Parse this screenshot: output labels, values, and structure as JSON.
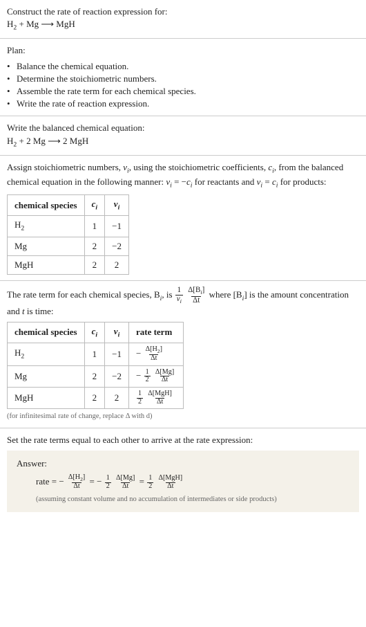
{
  "header": {
    "title": "Construct the rate of reaction expression for:",
    "equation_lhs1": "H",
    "equation_lhs1_sub": "2",
    "equation_plus": " + Mg ⟶ MgH"
  },
  "plan": {
    "title": "Plan:",
    "items": [
      "Balance the chemical equation.",
      "Determine the stoichiometric numbers.",
      "Assemble the rate term for each chemical species.",
      "Write the rate of reaction expression."
    ]
  },
  "balanced": {
    "heading": "Write the balanced chemical equation:",
    "eq_h": "H",
    "eq_h_sub": "2",
    "eq_rest": " + 2 Mg ⟶ 2 MgH"
  },
  "assign": {
    "text_a": "Assign stoichiometric numbers, ",
    "nu_i": "ν",
    "i_sub": "i",
    "text_b": ", using the stoichiometric coefficients, ",
    "c_i": "c",
    "text_c": ", from the balanced chemical equation in the following manner: ",
    "eq1_lhs": "ν",
    "eq1_eq": " = −",
    "eq1_rhs": "c",
    "text_d": " for reactants and ",
    "eq2_lhs": "ν",
    "eq2_eq": " = ",
    "eq2_rhs": "c",
    "text_e": " for products:"
  },
  "table1": {
    "h1": "chemical species",
    "h2": "c",
    "h2_sub": "i",
    "h3": "ν",
    "h3_sub": "i",
    "rows": [
      {
        "sp_h": "H",
        "sp_sub": "2",
        "c": "1",
        "nu": "−1"
      },
      {
        "sp": "Mg",
        "c": "2",
        "nu": "−2"
      },
      {
        "sp": "MgH",
        "c": "2",
        "nu": "2"
      }
    ]
  },
  "rate_intro": {
    "a": "The rate term for each chemical species, B",
    "i_sub": "i",
    "b": ", is ",
    "frac1_num": "1",
    "frac1_den_nu": "ν",
    "frac1_den_sub": "i",
    "frac2_num_d": "Δ[B",
    "frac2_num_close": "]",
    "frac2_den": "Δt",
    "c": " where [B",
    "d": "] is the amount concentration and ",
    "t": "t",
    "e": " is time:"
  },
  "table2": {
    "h1": "chemical species",
    "h2": "c",
    "h2_sub": "i",
    "h3": "ν",
    "h3_sub": "i",
    "h4": "rate term",
    "rows": [
      {
        "sp_h": "H",
        "sp_sub": "2",
        "c": "1",
        "nu": "−1",
        "sign": "−",
        "coef_num": "",
        "coef_den": "",
        "br_open": "Δ[H",
        "br_sub": "2",
        "br_close": "]",
        "den": "Δt"
      },
      {
        "sp": "Mg",
        "c": "2",
        "nu": "−2",
        "sign": "−",
        "coef_num": "1",
        "coef_den": "2",
        "br_open": "Δ[Mg",
        "br_sub": "",
        "br_close": "]",
        "den": "Δt"
      },
      {
        "sp": "MgH",
        "c": "2",
        "nu": "2",
        "sign": "",
        "coef_num": "1",
        "coef_den": "2",
        "br_open": "Δ[MgH",
        "br_sub": "",
        "br_close": "]",
        "den": "Δt"
      }
    ],
    "foot": "(for infinitesimal rate of change, replace Δ with d)"
  },
  "final": {
    "heading": "Set the rate terms equal to each other to arrive at the rate expression:",
    "answer_label": "Answer:",
    "rate_word": "rate = ",
    "assume": "(assuming constant volume and no accumulation of intermediates or side products)"
  }
}
